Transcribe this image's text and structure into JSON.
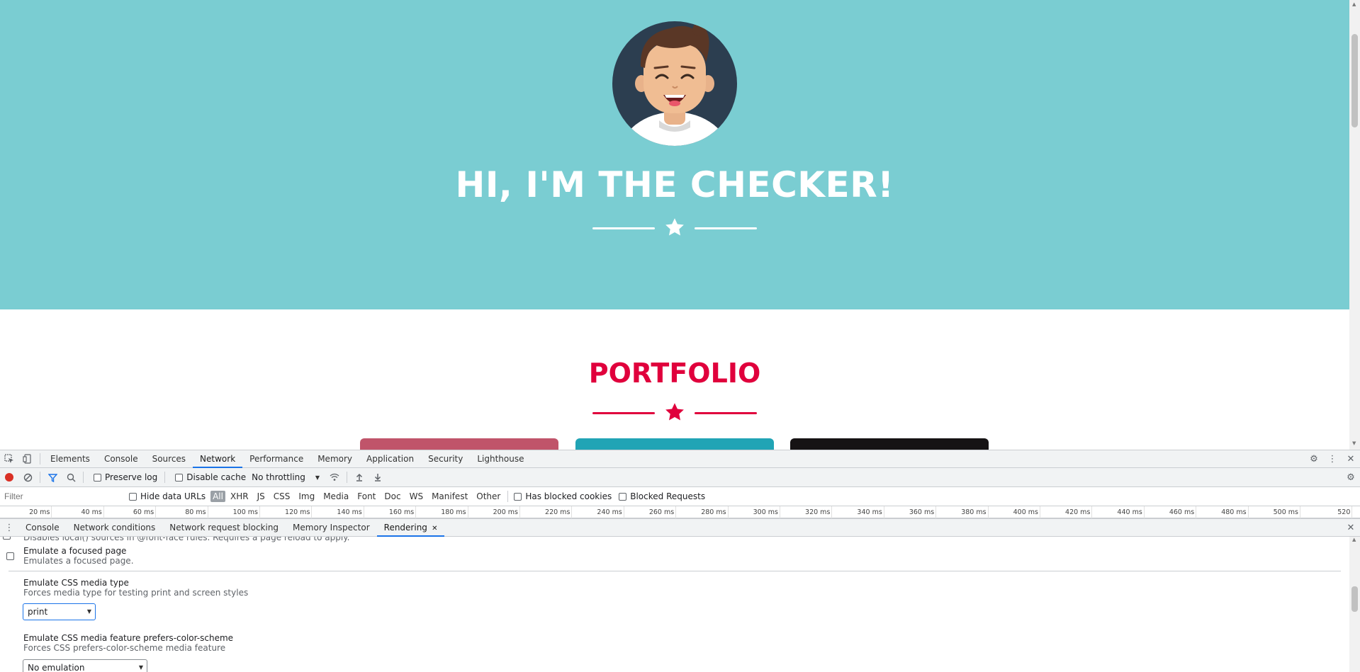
{
  "page": {
    "hero_title": "HI, I'M THE CHECKER!",
    "portfolio_title": "PORTFOLIO",
    "hero_bg": "#7acdd2",
    "accent": "#e0003c",
    "card_colors": [
      "#c0546a",
      "#21a4b5",
      "#161314"
    ]
  },
  "devtools": {
    "main_tabs": [
      "Elements",
      "Console",
      "Sources",
      "Network",
      "Performance",
      "Memory",
      "Application",
      "Security",
      "Lighthouse"
    ],
    "active_tab": "Network",
    "toolbar": {
      "preserve_log": "Preserve log",
      "disable_cache": "Disable cache",
      "throttling": "No throttling"
    },
    "filter": {
      "placeholder": "Filter",
      "hide_data_urls": "Hide data URLs",
      "types": [
        "All",
        "XHR",
        "JS",
        "CSS",
        "Img",
        "Media",
        "Font",
        "Doc",
        "WS",
        "Manifest",
        "Other"
      ],
      "selected_type": "All",
      "has_blocked_cookies": "Has blocked cookies",
      "blocked_requests": "Blocked Requests"
    },
    "timeline_ticks": [
      "20 ms",
      "40 ms",
      "60 ms",
      "80 ms",
      "100 ms",
      "120 ms",
      "140 ms",
      "160 ms",
      "180 ms",
      "200 ms",
      "220 ms",
      "240 ms",
      "260 ms",
      "280 ms",
      "300 ms",
      "320 ms",
      "340 ms",
      "360 ms",
      "380 ms",
      "400 ms",
      "420 ms",
      "440 ms",
      "460 ms",
      "480 ms",
      "500 ms",
      "520"
    ],
    "drawer_tabs": [
      "Console",
      "Network conditions",
      "Network request blocking",
      "Memory Inspector",
      "Rendering"
    ],
    "active_drawer_tab": "Rendering",
    "rendering": {
      "cut_text": "Disables local() sources in @font-face rules. Requires a page reload to apply.",
      "focused_title": "Emulate a focused page",
      "focused_sub": "Emulates a focused page.",
      "media_title": "Emulate CSS media type",
      "media_sub": "Forces media type for testing print and screen styles",
      "media_value": "print",
      "scheme_title": "Emulate CSS media feature prefers-color-scheme",
      "scheme_sub": "Forces CSS prefers-color-scheme media feature",
      "scheme_value": "No emulation"
    }
  }
}
